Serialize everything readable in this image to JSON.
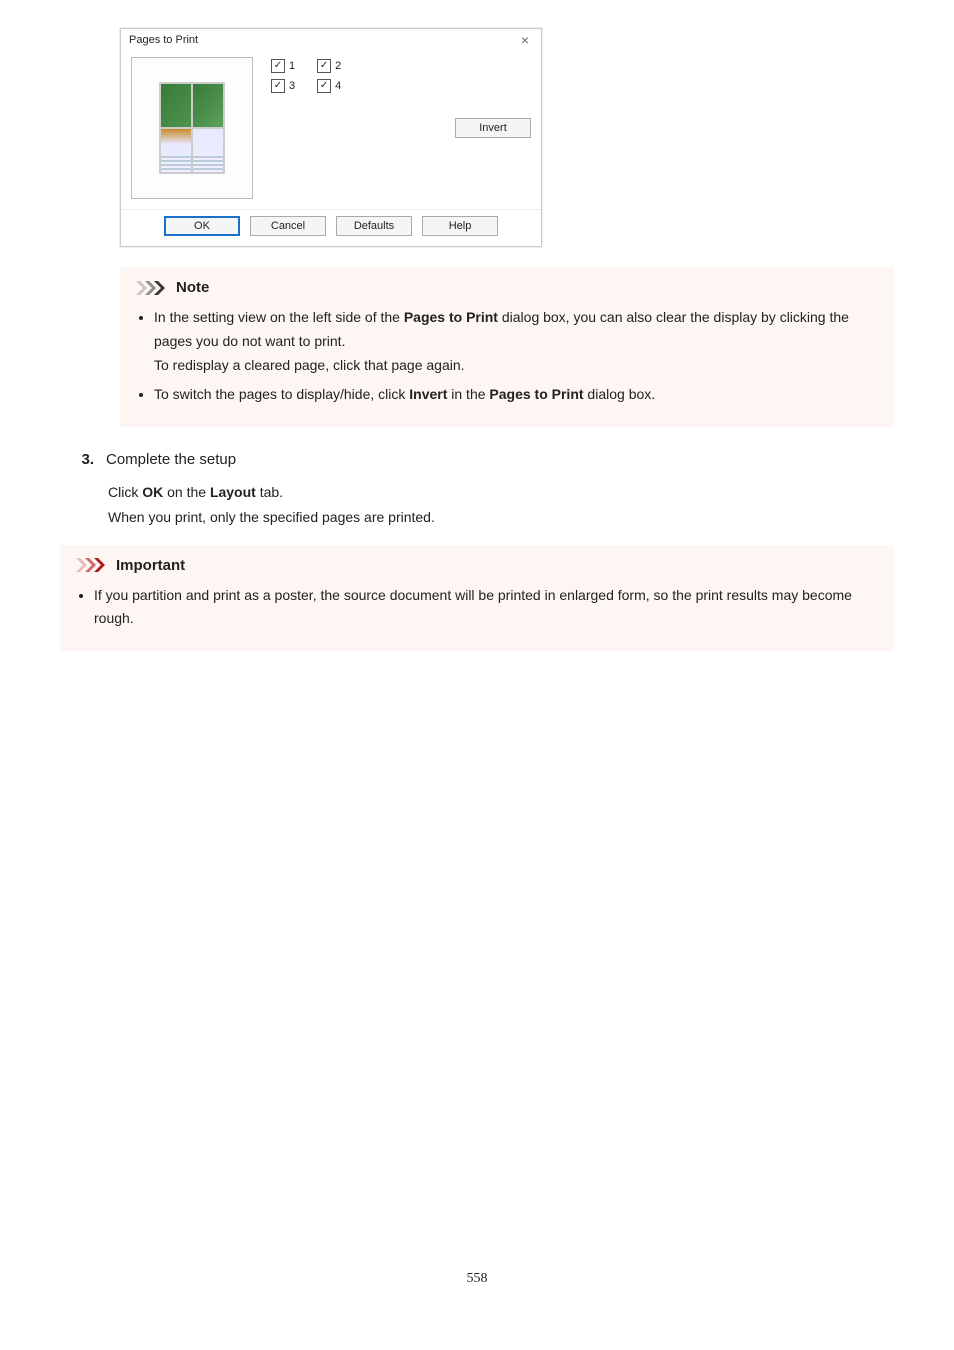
{
  "dialog": {
    "title": "Pages to Print",
    "checkboxes": {
      "c1": "1",
      "c2": "2",
      "c3": "3",
      "c4": "4"
    },
    "invert_btn": "Invert",
    "ok_btn": "OK",
    "cancel_btn": "Cancel",
    "defaults_btn": "Defaults",
    "help_btn": "Help"
  },
  "note": {
    "heading": "Note",
    "item1a": "In the setting view on the left side of the ",
    "item1b_bold": "Pages to Print",
    "item1c": " dialog box, you can also clear the display by clicking the pages you do not want to print.",
    "item1_sub": "To redisplay a cleared page, click that page again.",
    "item2a": "To switch the pages to display/hide, click ",
    "item2b_bold": "Invert",
    "item2c": " in the ",
    "item2d_bold": "Pages to Print",
    "item2e": " dialog box."
  },
  "step": {
    "number": "3.",
    "title": "Complete the setup",
    "desc1a": "Click ",
    "desc1b_bold": "OK",
    "desc1c": " on the ",
    "desc1d_bold": "Layout",
    "desc1e": " tab.",
    "desc2": "When you print, only the specified pages are printed."
  },
  "important": {
    "heading": "Important",
    "item1": "If you partition and print as a poster, the source document will be printed in enlarged form, so the print results may become rough."
  },
  "page_number": "558"
}
